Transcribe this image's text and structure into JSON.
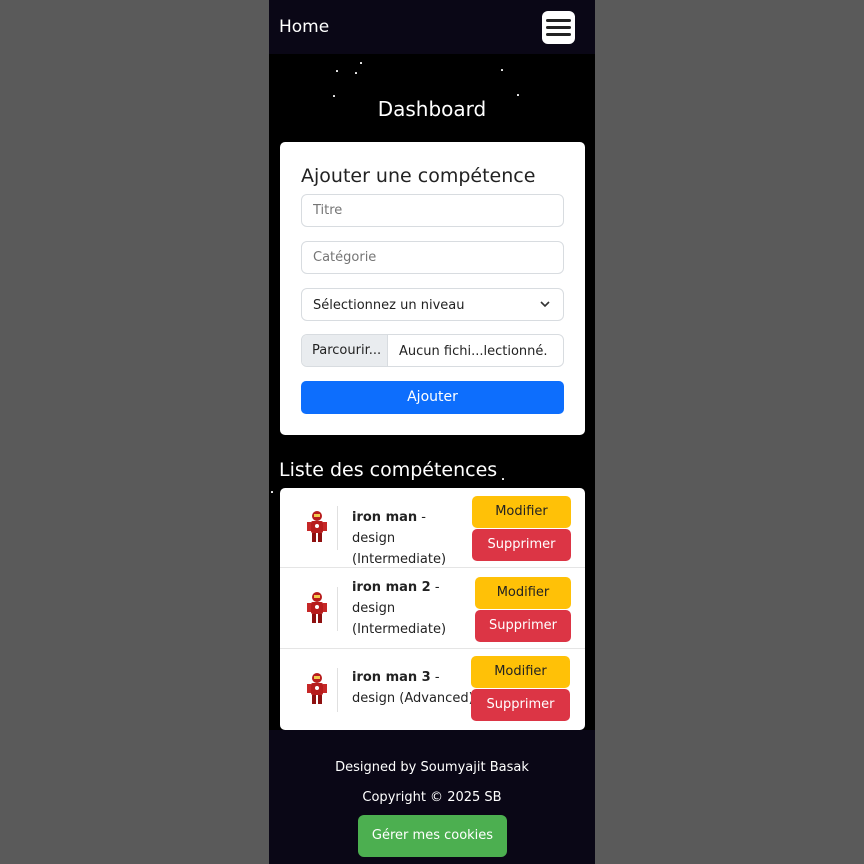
{
  "navbar": {
    "brand": "Home",
    "menu_icon": "hamburger-menu-icon"
  },
  "header": {
    "title": "Dashboard"
  },
  "form": {
    "title": "Ajouter une compétence",
    "title_placeholder": "Titre",
    "category_placeholder": "Catégorie",
    "level_select": "Sélectionnez un niveau",
    "file_button": "Parcourir...",
    "file_name": "Aucun fichi...lectionné.",
    "submit": "Ajouter"
  },
  "list": {
    "title": "Liste des compétences",
    "items": [
      {
        "name": "iron man",
        "category": "design",
        "level": "Intermediate",
        "edit": "Modifier",
        "delete": "Supprimer"
      },
      {
        "name": "iron man 2",
        "category": "design",
        "level": "Intermediate",
        "edit": "Modifier",
        "delete": "Supprimer"
      },
      {
        "name": "iron man 3",
        "category": "design",
        "level": "Advanced",
        "edit": "Modifier",
        "delete": "Supprimer"
      }
    ]
  },
  "footer": {
    "designed_by": "Designed by Soumyajit Basak",
    "copyright": "Copyright © 2025 SB",
    "cookies_button": "Gérer mes cookies"
  },
  "colors": {
    "primary": "#0d6efd",
    "warning": "#ffc107",
    "danger": "#dc3545",
    "cookie": "#4caf50",
    "navbar": "#0a0716"
  }
}
